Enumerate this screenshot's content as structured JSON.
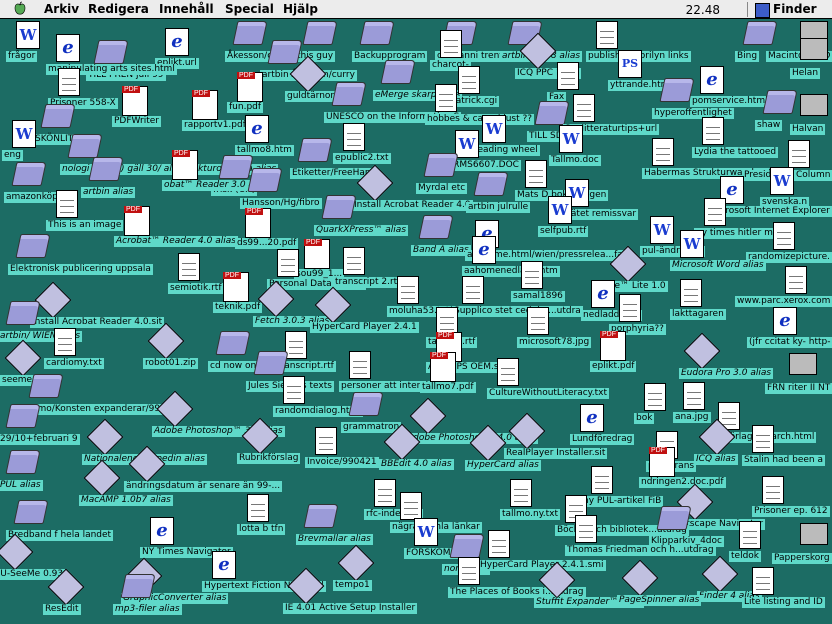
{
  "menubar": {
    "items": [
      "Arkiv",
      "Redigera",
      "Innehåll",
      "Special",
      "Hjälp"
    ],
    "clock": "22.48",
    "app_name": "Finder"
  },
  "desktop_icons": [
    {
      "label": "frågor",
      "kind": "wdoc"
    },
    {
      "label": "TILL PREN juli 99",
      "kind": "folder"
    },
    {
      "label": "eplikt.url",
      "kind": "ie"
    },
    {
      "label": "Åkesson/curry",
      "kind": "folder"
    },
    {
      "label": "this guy",
      "kind": "folder"
    },
    {
      "label": "Backupprogram",
      "kind": "folder"
    },
    {
      "label": "club anni trent",
      "kind": "folder"
    },
    {
      "label": "artbin jul 98 alias",
      "kind": "folder"
    },
    {
      "label": "publishing lorilyn links",
      "kind": "doc"
    },
    {
      "label": "Bing",
      "kind": "folder"
    },
    {
      "label": "Macintosh HD",
      "kind": "sys"
    },
    {
      "label": "manipulating arts sites.html",
      "kind": "ie"
    },
    {
      "label": "charcot-",
      "kind": "doc"
    },
    {
      "label": "artbin Åkesson/curry",
      "kind": "folder"
    },
    {
      "label": "ICQ PPC 1.7.2",
      "kind": "app"
    },
    {
      "label": "Fax",
      "kind": "doc"
    },
    {
      "label": "yttrande.html",
      "kind": "ps"
    },
    {
      "label": "Helan",
      "kind": "sys"
    },
    {
      "label": "Prisoner 558-X",
      "kind": "doc"
    },
    {
      "label": "fun.pdf",
      "kind": "pdf"
    },
    {
      "label": "guldtärnor",
      "kind": "app"
    },
    {
      "label": "eMerge skarp alias",
      "kind": "folder"
    },
    {
      "label": "patrick.cgi",
      "kind": "doc"
    },
    {
      "label": "pomservice.html",
      "kind": "ie"
    },
    {
      "label": "PDFWriter",
      "kind": "pdf"
    },
    {
      "label": "rapportv1.pdf",
      "kind": "pdf"
    },
    {
      "label": "UNESCO on the Information S",
      "kind": "folder"
    },
    {
      "label": "hobbes & carnal lust ??",
      "kind": "doc"
    },
    {
      "label": "hyperoffentlighet",
      "kind": "folder"
    },
    {
      "label": "shaw",
      "kind": "folder"
    },
    {
      "label": "Halvan",
      "kind": "sys"
    },
    {
      "label": "SKÖNLITT-99",
      "kind": "folder"
    },
    {
      "label": "TILL SDS",
      "kind": "folder"
    },
    {
      "label": "S-s litteraturtips+url",
      "kind": "doc"
    },
    {
      "label": "eng",
      "kind": "wdoc"
    },
    {
      "label": "tallmo8.htm",
      "kind": "ie"
    },
    {
      "label": "epublic2.txt",
      "kind": "doc"
    },
    {
      "label": "reading wheel",
      "kind": "wdoc"
    },
    {
      "label": "Lydia the tattooed",
      "kind": "doc"
    },
    {
      "label": "nologi (komb) gäll 30/ alias Fakturor.spara alias",
      "kind": "folder"
    },
    {
      "label": "Etiketter/FreeHand",
      "kind": "folder"
    },
    {
      "label": "ARMS6607.DOC",
      "kind": "wdoc"
    },
    {
      "label": "Tallmo.doc",
      "kind": "wdoc"
    },
    {
      "label": "Habermas Strukturwand...utd",
      "kind": "doc"
    },
    {
      "label": "President's Column",
      "kind": "doc"
    },
    {
      "label": "frisk (OA)",
      "kind": "folder"
    },
    {
      "label": "amazonköp",
      "kind": "folder"
    },
    {
      "label": "artbin alias",
      "kind": "folder"
    },
    {
      "label": "obat™ Reader 3.0 alias",
      "kind": "pdf"
    },
    {
      "label": "Hansson/Hg/fibro",
      "kind": "folder"
    },
    {
      "label": "Myrdal etc",
      "kind": "folder"
    },
    {
      "label": "Mats D boktips igen",
      "kind": "doc"
    },
    {
      "label": "svenska.n",
      "kind": "wdoc"
    },
    {
      "label": "Install Acrobat Reader 4.0",
      "kind": "app"
    },
    {
      "label": "artbin julrulle",
      "kind": "folder"
    },
    {
      "label": "K-nätet remissvar",
      "kind": "wdoc"
    },
    {
      "label": "Microsoft Internet Explorer",
      "kind": "ie"
    },
    {
      "label": "This is an image",
      "kind": "doc"
    },
    {
      "label": "QuarkXPress™ alias",
      "kind": "folder"
    },
    {
      "label": "selfpub.rtf",
      "kind": "wdoc"
    },
    {
      "label": "ny times hitler m.m.",
      "kind": "doc"
    },
    {
      "label": "Acrobat™ Reader 4.0 alias",
      "kind": "pdf"
    },
    {
      "label": "ds99...20.pdf",
      "kind": "pdf"
    },
    {
      "label": "Band A alias",
      "kind": "folder"
    },
    {
      "label": "pul-ändringar",
      "kind": "wdoc"
    },
    {
      "label": "randomizepicture.",
      "kind": "doc"
    },
    {
      "label": "Elektronisk publicering uppsala",
      "kind": "folder"
    },
    {
      "label": "sou99_1...",
      "kind": "pdf"
    },
    {
      "label": "aashome.html/wien/pressrelea...fax",
      "kind": "ie"
    },
    {
      "label": "Microsoft Word alias",
      "kind": "wdoc"
    },
    {
      "label": "Personal Data Mining",
      "kind": "doc"
    },
    {
      "label": "transcript 2.rtf",
      "kind": "doc"
    },
    {
      "label": "aahomenedladd.htm",
      "kind": "ie"
    },
    {
      "label": "semiotik.rtf",
      "kind": "doc"
    },
    {
      "label": "samal1896",
      "kind": "doc"
    },
    {
      "label": "ille™ Lite 1.0",
      "kind": "app"
    },
    {
      "label": "www.parc.xerox.com",
      "kind": "doc"
    },
    {
      "label": "teknik.pdf",
      "kind": "pdf"
    },
    {
      "label": "moluha53.txt",
      "kind": "doc"
    },
    {
      "label": "Supplico stet cedula ...utdra",
      "kind": "doc"
    },
    {
      "label": "nedladd.htm",
      "kind": "ie"
    },
    {
      "label": "lakttagaren",
      "kind": "doc"
    },
    {
      "label": "Install Acrobat Reader 4.0.sit",
      "kind": "app"
    },
    {
      "label": "Fetch 3.0.3 alias",
      "kind": "app"
    },
    {
      "label": "HyperCard Player 2.4.1",
      "kind": "app"
    },
    {
      "label": "porphyria??",
      "kind": "doc"
    },
    {
      "label": "artbin/ WIEN alias",
      "kind": "folder"
    },
    {
      "label": "tallmo8.rtf",
      "kind": "doc"
    },
    {
      "label": "microsoft78.jpg",
      "kind": "doc"
    },
    {
      "label": "(jfr ccitat ky- http-",
      "kind": "ie"
    },
    {
      "label": "cardiomy.txt",
      "kind": "doc"
    },
    {
      "label": "robot01.zip",
      "kind": "app"
    },
    {
      "label": "cd now on",
      "kind": "folder"
    },
    {
      "label": "transcript.rtf",
      "kind": "doc"
    },
    {
      "label": "AdobePS OEM.sit",
      "kind": "pdf"
    },
    {
      "label": "eplikt.pdf",
      "kind": "pdf"
    },
    {
      "label": "Eudora Pro 3.0 alias",
      "kind": "app"
    },
    {
      "label": "seemee.sit",
      "kind": "app"
    },
    {
      "label": "Jules Siegel's texts",
      "kind": "folder"
    },
    {
      "label": "personer att intervjua",
      "kind": "doc"
    },
    {
      "label": "tallmo7.pdf",
      "kind": "pdf"
    },
    {
      "label": "CultureWithoutLiteracy.txt",
      "kind": "doc"
    },
    {
      "label": "FRN riter II NT",
      "kind": "sys"
    },
    {
      "label": "Tallmo/Konsten expanderar/9904",
      "kind": "folder"
    },
    {
      "label": "randomdialog.html",
      "kind": "doc"
    },
    {
      "label": "bok",
      "kind": "doc"
    },
    {
      "label": "ana.jpg",
      "kind": "doc"
    },
    {
      "label": "29/10+februari 9",
      "kind": "folder"
    },
    {
      "label": "Adobe Photoshop™ 3.0 alias",
      "kind": "app"
    },
    {
      "label": "grammatron",
      "kind": "folder"
    },
    {
      "label": "Adobe Photoshop® 4.0 alias",
      "kind": "app"
    },
    {
      "label": "Lundföredrag",
      "kind": "ie"
    },
    {
      "label": "bokförlag nsearch.html",
      "kind": "doc"
    },
    {
      "label": "Nationalencyklopedin alias",
      "kind": "app"
    },
    {
      "label": "Rubrikförslag",
      "kind": "app"
    },
    {
      "label": "Invoice/990421",
      "kind": "doc"
    },
    {
      "label": "BBEdit 4.0 alias",
      "kind": "app"
    },
    {
      "label": "HyperCard alias",
      "kind": "app"
    },
    {
      "label": "RealPlayer Installer.sit",
      "kind": "app"
    },
    {
      "label": "ICQ alias",
      "kind": "app"
    },
    {
      "label": "para frans",
      "kind": "doc"
    },
    {
      "label": "Stalin had been a",
      "kind": "doc"
    },
    {
      "label": "PUL alias",
      "kind": "folder"
    },
    {
      "label": "ändringsdatum är senare än 99-...",
      "kind": "app"
    },
    {
      "label": "ndringen2.doc.pdf",
      "kind": "pdf"
    },
    {
      "label": "MacAMP 1.0b7 alias",
      "kind": "app"
    },
    {
      "label": "rfc-index.txt",
      "kind": "doc"
    },
    {
      "label": "tallmo.ny.txt",
      "kind": "doc"
    },
    {
      "label": "ny PUL-artikel FiB",
      "kind": "doc"
    },
    {
      "label": "Netscape Navigator",
      "kind": "app"
    },
    {
      "label": "Prisoner ep. 612",
      "kind": "doc"
    },
    {
      "label": "Bredband f hela landet",
      "kind": "folder"
    },
    {
      "label": "lotta b tfn",
      "kind": "doc"
    },
    {
      "label": "Brevmallar alias",
      "kind": "folder"
    },
    {
      "label": "nägra gamla länkar",
      "kind": "doc"
    },
    {
      "label": "Böcker och bibliotek...utdrag",
      "kind": "doc"
    },
    {
      "label": "Klipparkiv_4doc",
      "kind": "folder"
    },
    {
      "label": "NY Times Navigator",
      "kind": "ie"
    },
    {
      "label": "FORSKOM1.doc",
      "kind": "wdoc"
    },
    {
      "label": "Thomas Friedman och h...utdrag",
      "kind": "doc"
    },
    {
      "label": "teldok",
      "kind": "doc"
    },
    {
      "label": "Papperskorg",
      "kind": "sys"
    },
    {
      "label": "CU-SeeMe 0.93",
      "kind": "app"
    },
    {
      "label": "Hypertext Fiction NYT.html",
      "kind": "ie"
    },
    {
      "label": "norg alias",
      "kind": "folder"
    },
    {
      "label": "HyperCard Player 2.4.1.smi",
      "kind": "doc"
    },
    {
      "label": "tempo1",
      "kind": "app"
    },
    {
      "label": "GraphicConverter alias",
      "kind": "app"
    },
    {
      "label": "The Places of Books i...utdrag",
      "kind": "doc"
    },
    {
      "label": "Stuffit Expander™ alias",
      "kind": "app"
    },
    {
      "label": "Finder 4 alias",
      "kind": "app"
    },
    {
      "label": "ResEdit",
      "kind": "app"
    },
    {
      "label": "mp3-filer alias",
      "kind": "folder"
    },
    {
      "label": "IE 4.01 Active Setup Installer",
      "kind": "app"
    },
    {
      "label": "PageSpinner alias",
      "kind": "app"
    },
    {
      "label": "Lite listing and ID",
      "kind": "doc"
    }
  ]
}
